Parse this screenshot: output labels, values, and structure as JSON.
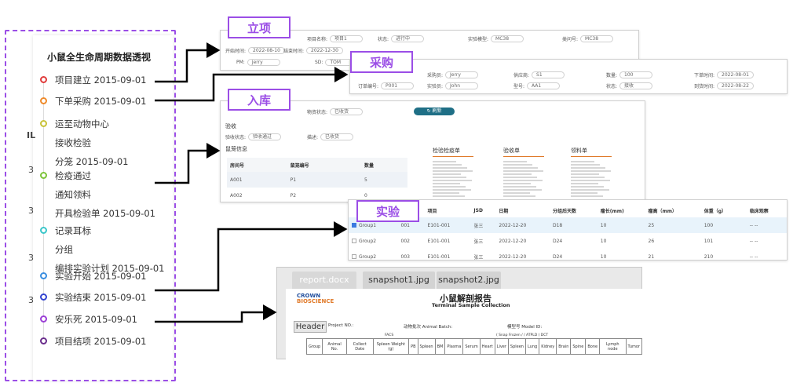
{
  "timeline": {
    "title": "小鼠全生命周期数据透视",
    "side_stubs": [
      "IL",
      "3",
      "3",
      "3",
      "3"
    ],
    "items": [
      {
        "lines": [
          "项目建立 2015-09-01"
        ],
        "color": "#e03b3b"
      },
      {
        "lines": [
          "下单采购 2015-09-01"
        ],
        "color": "#ef8a2a"
      },
      {
        "lines": [
          "运至动物中心",
          "接收检验",
          "分笼 2015-09-01"
        ],
        "color": "#c8c23a"
      },
      {
        "lines": [
          "检疫通过",
          "通知领料",
          "开具检验单 2015-09-01"
        ],
        "color": "#7cc43a"
      },
      {
        "lines": [
          "记录耳标",
          "分组",
          "编排实验计划 2015-09-01"
        ],
        "color": "#3ac6c9"
      },
      {
        "lines": [
          "实验开始 2015-09-01"
        ],
        "color": "#3a8ee0"
      },
      {
        "lines": [
          "实验结束 2015-09-01"
        ],
        "color": "#3344d0"
      },
      {
        "lines": [
          "安乐死 2015-09-01"
        ],
        "color": "#9b3fd6"
      },
      {
        "lines": [
          "项目结项 2015-09-01"
        ],
        "color": "#6a2d8c"
      }
    ]
  },
  "tags": {
    "lixiang": "立项",
    "caigou": "采购",
    "ruku": "入库",
    "shiyan": "实验",
    "chuzhi": "处置"
  },
  "project_panel": {
    "row1": [
      [
        "项目名称:",
        "项目1"
      ],
      [
        "状态:",
        "进行中"
      ],
      [
        "实验模型:",
        "MC38"
      ],
      [
        "类问号:",
        "MC38"
      ]
    ],
    "row2": [
      [
        "开始时间:",
        "2022-08-10"
      ],
      [
        "结束时间:",
        "2022-12-30"
      ]
    ],
    "row3": [
      [
        "PM:",
        "Jerry"
      ],
      [
        "SD:",
        "TOM"
      ]
    ]
  },
  "purchase_panel": {
    "row1": [
      [
        "采购员:",
        "Jerry"
      ],
      [
        "供应商:",
        "S1"
      ],
      [
        "数量:",
        "100"
      ],
      [
        "下单时间:",
        "2022-08-01"
      ]
    ],
    "row2": [
      [
        "订单编号:",
        "P001"
      ],
      [
        "实验员:",
        "John"
      ],
      [
        "型号:",
        "AA1"
      ],
      [
        "状态:",
        "接收"
      ],
      [
        "到货时间:",
        "2022-08-22"
      ]
    ]
  },
  "inbound_panel": {
    "row1": [
      [
        "物资状态:",
        "已收货"
      ]
    ],
    "button": "刷新",
    "section_accept": "验收",
    "row2": [
      [
        "验收状态:",
        "验收通过"
      ],
      [
        "描述:",
        "已收货"
      ]
    ],
    "cage_title": "鼠笼信息",
    "cage_headers": [
      "房间号",
      "鼠笼编号",
      "数量"
    ],
    "cage_rows": [
      [
        "A001",
        "P1",
        "5"
      ],
      [
        "A002",
        "P2",
        "0"
      ]
    ],
    "docs": [
      "检验检疫单",
      "验收单",
      "领料单"
    ]
  },
  "experiment_panel": {
    "headers": [
      "",
      "组ID",
      "项目",
      "JSD",
      "日期",
      "分组后天数",
      "瘤长(mm)",
      "瘤高（mm）",
      "体重（g）",
      "临床观察"
    ],
    "rows": [
      [
        "Group1",
        "001",
        "E101-001",
        "张三",
        "2022-12-20",
        "D18",
        "10",
        "25",
        "100",
        "-- --",
        true
      ],
      [
        "Group2",
        "002",
        "E101-001",
        "张三",
        "2022-12-20",
        "D24",
        "10",
        "26",
        "101",
        "-- --",
        false
      ],
      [
        "Group2",
        "003",
        "E101-001",
        "张三",
        "2022-12-20",
        "D24",
        "10",
        "21",
        "210",
        "-- --",
        false
      ]
    ]
  },
  "report_panel": {
    "tabs": [
      "report.docx",
      "snapshot1.jpg",
      "snapshot2.jpg"
    ],
    "logo_top": "CROWN",
    "logo_bottom": "BIOSCIENCE",
    "title": "小鼠解剖报告",
    "subtitle": "Terminal Sample Collection",
    "header_label": "Header",
    "project_no": "Project NO.:",
    "batch": "动物批次 Animal Batch:",
    "model": "模型号 Model ID:",
    "table_headers": [
      "Group",
      "Animal No.",
      "Collect Date",
      "Spleen Weight (g)",
      "PB",
      "Spleen",
      "BM",
      "Plasma",
      "Serum",
      "Heart",
      "Liver",
      "Spleen",
      "Lung",
      "Kidney",
      "Brain",
      "Spine",
      "Bone",
      "Lymph node",
      "Tumor"
    ],
    "facs": "FACS",
    "snap": "( Snap Frozen / / ATPLD ) DCT"
  }
}
